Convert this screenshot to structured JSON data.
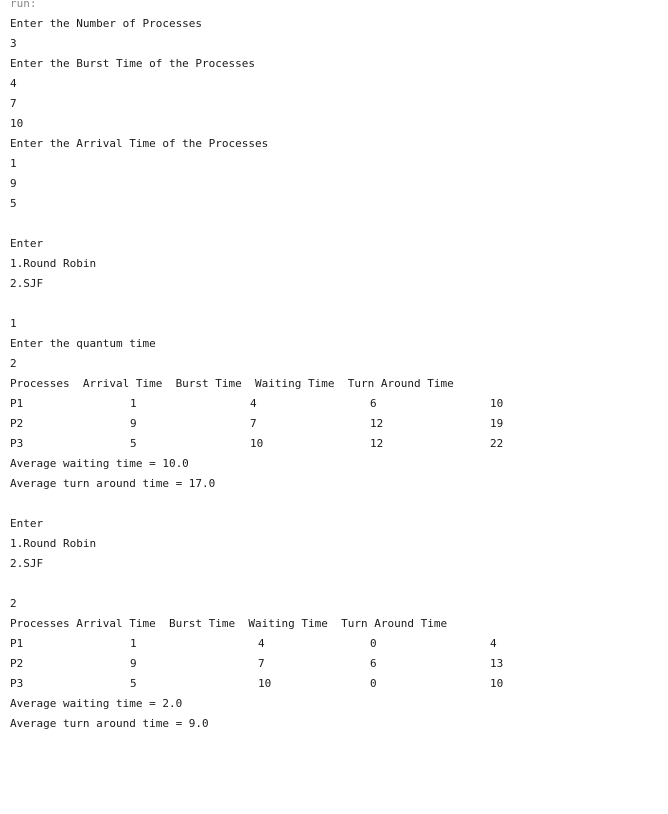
{
  "output_label": "run:",
  "lines": [
    "Enter the Number of Processes",
    "3",
    "Enter the Burst Time of the Processes",
    "4",
    "7",
    "10",
    "Enter the Arrival Time of the Processes",
    "1",
    "9",
    "5",
    "",
    "Enter",
    "1.Round Robin",
    "2.SJF",
    "",
    "1",
    "Enter the quantum time",
    "2"
  ],
  "table1": {
    "header": "Processes  Arrival Time  Burst Time  Waiting Time  Turn Around Time",
    "rows": [
      {
        "p": "P1",
        "at": "1",
        "bt": "4",
        "wt": "6",
        "tat": "10"
      },
      {
        "p": "P2",
        "at": "9",
        "bt": "7",
        "wt": "12",
        "tat": "19"
      },
      {
        "p": "P3",
        "at": "5",
        "bt": "10",
        "wt": "12",
        "tat": "22"
      }
    ],
    "avg_waiting": "Average waiting time = 10.0",
    "avg_tat": "Average turn around time = 17.0"
  },
  "lines2": [
    "",
    "Enter",
    "1.Round Robin",
    "2.SJF",
    "",
    "2"
  ],
  "table2": {
    "header": "Processes Arrival Time  Burst Time  Waiting Time  Turn Around Time",
    "rows": [
      {
        "p": "P1",
        "at": "1",
        "bt": "4",
        "wt": "0",
        "tat": "4"
      },
      {
        "p": "P2",
        "at": "9",
        "bt": "7",
        "wt": "6",
        "tat": "13"
      },
      {
        "p": "P3",
        "at": "5",
        "bt": "10",
        "wt": "0",
        "tat": "10"
      }
    ],
    "avg_waiting": "Average waiting time = 2.0",
    "avg_tat": "Average turn around time = 9.0"
  }
}
